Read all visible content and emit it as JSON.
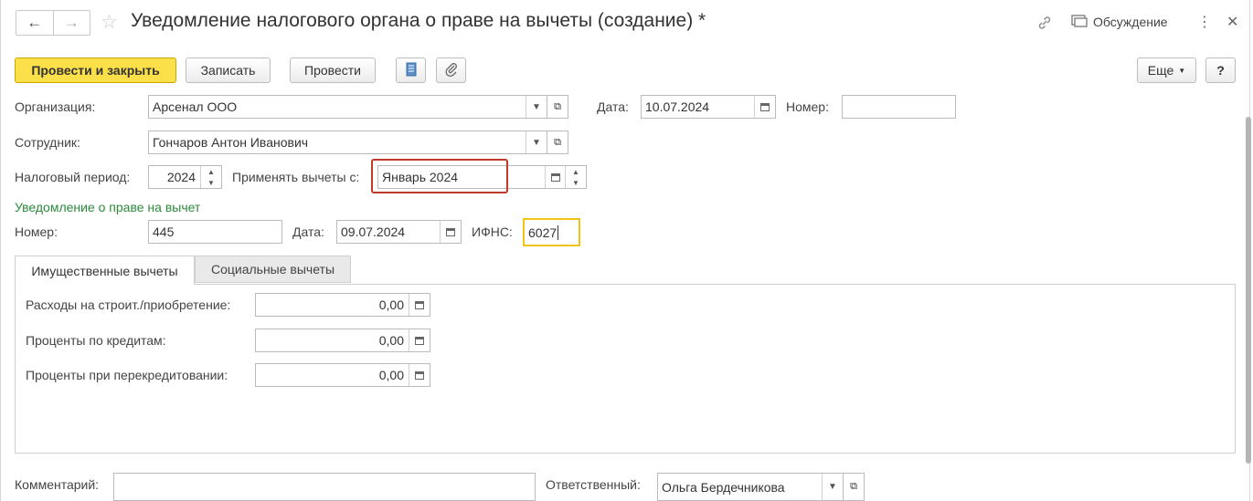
{
  "window": {
    "title": "Уведомление налогового органа о праве на вычеты (создание) *",
    "nav_back": "←",
    "nav_forward": "→",
    "star": "☆",
    "link_icon": "⛓",
    "discussion_label": "Обсуждение",
    "more_menu": "⋮",
    "close": "✕"
  },
  "toolbar": {
    "post_close_label": "Провести и закрыть",
    "save_label": "Записать",
    "post_label": "Провести",
    "more_label": "Еще",
    "help_label": "?"
  },
  "form": {
    "org_label": "Организация:",
    "org_value": "Арсенал ООО",
    "date_label": "Дата:",
    "date_value": "10.07.2024",
    "number_label": "Номер:",
    "number_value": "",
    "employee_label": "Сотрудник:",
    "employee_value": "Гончаров Антон Иванович",
    "tax_period_label": "Налоговый период:",
    "tax_period_value": "2024",
    "apply_from_label": "Применять вычеты с:",
    "apply_from_value": "Январь 2024",
    "notice_section_title": "Уведомление о праве на вычет",
    "notice_number_label": "Номер:",
    "notice_number_value": "445",
    "notice_date_label": "Дата:",
    "notice_date_value": "09.07.2024",
    "ifns_label": "ИФНС:",
    "ifns_value": "6027"
  },
  "tabs": [
    {
      "label": "Имущественные вычеты",
      "active": true
    },
    {
      "label": "Социальные вычеты",
      "active": false
    }
  ],
  "property_deductions": {
    "rows": [
      {
        "label": "Расходы на строит./приобретение:",
        "value": "0,00"
      },
      {
        "label": "Проценты по кредитам:",
        "value": "0,00"
      },
      {
        "label": "Проценты при перекредитовании:",
        "value": "0,00"
      }
    ]
  },
  "footer": {
    "comment_label": "Комментарий:",
    "comment_value": "",
    "responsible_label": "Ответственный:",
    "responsible_value": "Ольга Бердечникова"
  },
  "colors": {
    "primary_button": "#fbe04a",
    "highlight_red": "#c0392b",
    "focus_yellow": "#f2c313",
    "section_green": "#2d8a3c"
  }
}
